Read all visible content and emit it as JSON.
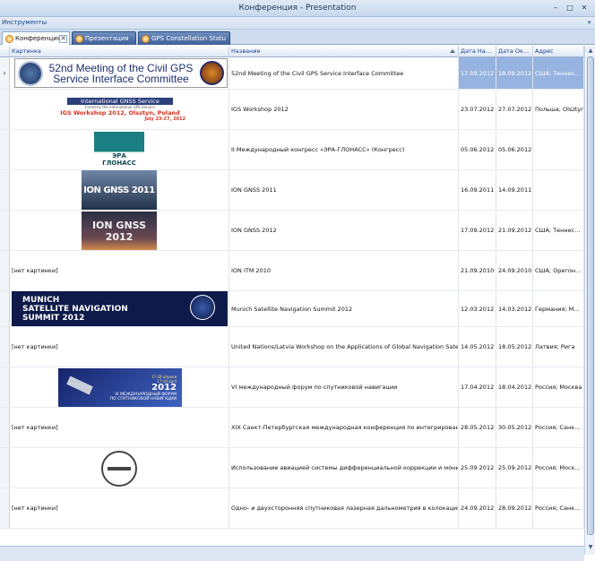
{
  "window": {
    "title": "Конференция - Presentation"
  },
  "menu": {
    "tools": "Инструменты"
  },
  "tabs": [
    {
      "label": "Конференция",
      "active": true
    },
    {
      "label": "Презентация",
      "active": false
    },
    {
      "label": "GPS Constellation Statu",
      "active": false
    }
  ],
  "columns": {
    "picture": "Картинка",
    "name": "Название",
    "start": "Дата На...",
    "end": "Дата Ок...",
    "address": "Адрес"
  },
  "rows": [
    {
      "name": "52nd Meeting of the Civil GPS Service Interface Committee",
      "start": "17.09.2012",
      "end": "18.09.2012",
      "address": "США; Теннес...",
      "selected": true,
      "image": {
        "lines": [
          "52nd Meeting of the Civil GPS",
          "Service Interface Committee"
        ]
      }
    },
    {
      "name": "IGS Workshop 2012",
      "start": "23.07.2012",
      "end": "27.07.2012",
      "address": "Польша; Olsztyn",
      "image": {
        "lines": [
          "International GNSS Service",
          "Formerly the International GPS Service",
          "IGS Workshop 2012, Olsztyn, Poland",
          "July 23-27, 2012"
        ]
      }
    },
    {
      "name": "II Международный конгресс «ЭРА-ГЛОНАСС» (Конгресс)",
      "start": "05.06.2012",
      "end": "05.06.2012",
      "address": "",
      "image": {
        "lines": [
          "ЭРА",
          "ГЛОНАСС"
        ]
      }
    },
    {
      "name": "ION GNSS 2011",
      "start": "16.09.2011",
      "end": "14.09.2011",
      "address": "",
      "image": {
        "lines": [
          "ION GNSS 2011"
        ]
      }
    },
    {
      "name": "ION GNSS 2012",
      "start": "17.09.2012",
      "end": "21.09.2012",
      "address": "США; Теннес...",
      "image": {
        "lines": [
          "ION GNSS",
          "2012"
        ]
      }
    },
    {
      "name": "ION ITM 2010",
      "start": "21.09.2010",
      "end": "24.09.2010",
      "address": "США; Орегон...",
      "no_image": "[нет картинки]"
    },
    {
      "name": "Munich Satellite Navigation Summit 2012",
      "start": "12.03.2012",
      "end": "14.03.2012",
      "address": "Германия; М...",
      "image": {
        "lines": [
          "MUNICH",
          "SATELLITE NAVIGATION",
          "SUMMIT 2012"
        ]
      }
    },
    {
      "name": "United Nations/Latvia Workshop on the Applications of Global Navigation Satellite ...",
      "start": "14.05.2012",
      "end": "18.05.2012",
      "address": "Латвия; Рига",
      "no_image": "[нет картинки]"
    },
    {
      "name": "VI международный форум по спутниковой навигации",
      "start": "17.04.2012",
      "end": "18.04.2012",
      "address": "Россия; Москва",
      "image": {
        "lines": [
          "17-18 апреля",
          "17-18 april",
          "2012",
          "VI МЕЖДУНАРОДНЫЙ ФОРУМ",
          "ПО СПУТНИКОВОЙ НАВИГАЦИИ"
        ]
      }
    },
    {
      "name": "XIX Санкт-Петербургская международная конференция по интегрированны...",
      "start": "28.05.2012",
      "end": "30.05.2012",
      "address": "Россия; Санк...",
      "no_image": "[нет картинки]"
    },
    {
      "name": "Использование авиацией системы дифференциальной коррекции и монитори...",
      "start": "25.09.2012",
      "end": "25.09.2012",
      "address": "Россия; Моск...",
      "image": {
        "lines": []
      }
    },
    {
      "name": "Одно- и двухсторонняя спутниковая лазерная дальнометрия в колокации с ...",
      "start": "24.09.2012",
      "end": "28.09.2012",
      "address": "Россия; Санк...",
      "no_image": "[нет картинки]"
    }
  ],
  "colors": {
    "selection": "#97b4e0",
    "header_text": "#15428b"
  }
}
